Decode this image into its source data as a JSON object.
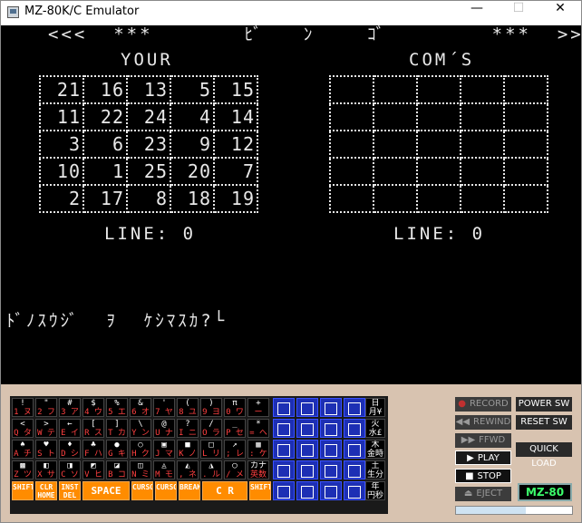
{
  "window": {
    "title": "MZ-80K/C Emulator",
    "minimize": "—",
    "maximize": "☐",
    "close": "✕"
  },
  "screen": {
    "header": "<<<  ***       ﾋﾞ   ﾝ    ｺﾞ        ***  >>>",
    "your_label": "YOUR",
    "com_label": "COM´S",
    "your_board": [
      [
        "21",
        "16",
        "13",
        "5",
        "15"
      ],
      [
        "11",
        "22",
        "24",
        "4",
        "14"
      ],
      [
        "3",
        "6",
        "23",
        "9",
        "12"
      ],
      [
        "10",
        "1",
        "25",
        "20",
        "7"
      ],
      [
        "2",
        "17",
        "8",
        "18",
        "19"
      ]
    ],
    "com_board": [
      [
        "",
        "",
        "",
        "",
        ""
      ],
      [
        "",
        "",
        "",
        "",
        ""
      ],
      [
        "",
        "",
        "",
        "",
        ""
      ],
      [
        "",
        "",
        "",
        "",
        ""
      ],
      [
        "",
        "",
        "",
        "",
        ""
      ]
    ],
    "your_line": "LINE: 0",
    "com_line": "LINE: 0",
    "prompt": "ﾄﾞﾉｽｳｼﾞ  ｦ  ｹｼﾏｽｶ?└"
  },
  "keyboard": {
    "row1": [
      {
        "t": "!",
        "b": "1 ヌ"
      },
      {
        "t": "\"",
        "b": "2 フ"
      },
      {
        "t": "#",
        "b": "3 ア"
      },
      {
        "t": "$",
        "b": "4 ウ"
      },
      {
        "t": "%",
        "b": "5 エ"
      },
      {
        "t": "&",
        "b": "6 オ"
      },
      {
        "t": "'",
        "b": "7 ヤ"
      },
      {
        "t": "(",
        "b": "8 ユ"
      },
      {
        "t": ")",
        "b": "9 ヨ"
      },
      {
        "t": "π",
        "b": "0 ワ"
      },
      {
        "t": "+",
        "b": "ー ホ"
      }
    ],
    "row2": [
      {
        "t": "<",
        "b": "Q タ"
      },
      {
        "t": ">",
        "b": "W テ"
      },
      {
        "t": "←",
        "b": "E イ"
      },
      {
        "t": "[",
        "b": "R ス"
      },
      {
        "t": "]",
        "b": "T カ"
      },
      {
        "t": "\\",
        "b": "Y ン"
      },
      {
        "t": "@",
        "b": "U ナ"
      },
      {
        "t": "?",
        "b": "I ニ"
      },
      {
        "t": "/",
        "b": "O ラ"
      },
      {
        "t": "_",
        "b": "P セ"
      },
      {
        "t": "*",
        "b": "= ヘ"
      }
    ],
    "row3": [
      {
        "t": "♠",
        "b": "A チ"
      },
      {
        "t": "♥",
        "b": "S ト"
      },
      {
        "t": "♦",
        "b": "D シ"
      },
      {
        "t": "♣",
        "b": "F ハ"
      },
      {
        "t": "●",
        "b": "G キ"
      },
      {
        "t": "○",
        "b": "H ク"
      },
      {
        "t": "▣",
        "b": "J マ"
      },
      {
        "t": "■",
        "b": "K ノ"
      },
      {
        "t": "□",
        "b": "L リ"
      },
      {
        "t": "↗",
        "b": "; レ"
      },
      {
        "t": "▦",
        "b": ": ケ"
      }
    ],
    "row4": [
      {
        "t": "▩",
        "b": "Z ツ"
      },
      {
        "t": "◧",
        "b": "X サ"
      },
      {
        "t": "◨",
        "b": "C ソ"
      },
      {
        "t": "◩",
        "b": "V ヒ"
      },
      {
        "t": "◪",
        "b": "B コ"
      },
      {
        "t": "◫",
        "b": "N ミ"
      },
      {
        "t": "◬",
        "b": "M モ"
      },
      {
        "t": "◭",
        "b": ", ネ"
      },
      {
        "t": "◮",
        "b": ". ル"
      },
      {
        "t": "◯",
        "b": "/ メ"
      },
      {
        "t": "カナ",
        "b": "英数"
      }
    ],
    "right_col": [
      "日\n月¥",
      "火\n水£",
      "木\n金時",
      "土\n生分",
      "年\n円秒"
    ],
    "bottom": {
      "shift_left": "SHIFT",
      "clr_home": "CLR\nHOME",
      "inst_del": "INST\nDEL",
      "space": "SPACE",
      "cursor_ud": "CURSOR",
      "cursor_lr": "CURSOR",
      "break": "BREAK",
      "cr": "C R",
      "shift_right": "SHIFT"
    }
  },
  "controls": {
    "record": "RECORD",
    "rewind": "REWIND",
    "ffwd": "FFWD",
    "play": "PLAY",
    "stop": "STOP",
    "eject": "EJECT",
    "power_sw": "POWER SW",
    "reset_sw": "RESET SW",
    "quick_load": "QUICK LOAD",
    "logo": "MZ-80"
  },
  "tape_progress": 0.6
}
